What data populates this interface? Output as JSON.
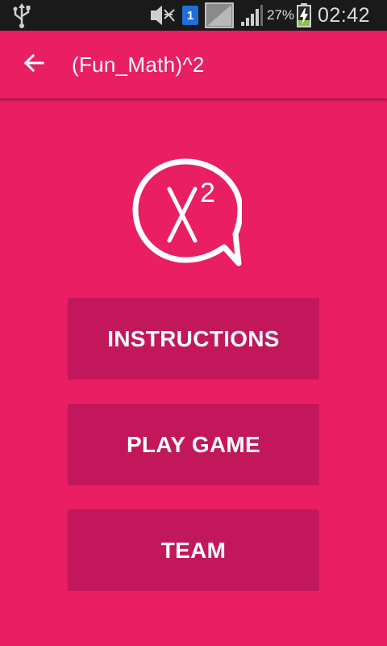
{
  "status_bar": {
    "icons": [
      "usb-icon",
      "mute-icon",
      "notification-badge-icon",
      "image-thumbnail-icon",
      "signal-icon",
      "battery-charging-icon"
    ],
    "notification_count": "1",
    "battery_percent": "27%",
    "time": "02:42"
  },
  "app_bar": {
    "back_icon": "arrow-back-icon",
    "title": "(Fun_Math)^2"
  },
  "logo": {
    "icon": "x-squared-speech-bubble-icon",
    "text_base": "X",
    "text_exponent": "2"
  },
  "menu": {
    "instructions_label": "INSTRUCTIONS",
    "play_game_label": "PLAY GAME",
    "team_label": "TEAM"
  },
  "colors": {
    "primary": "#e91e63",
    "button": "#c2185b",
    "status_bar": "#1a1a1a"
  }
}
